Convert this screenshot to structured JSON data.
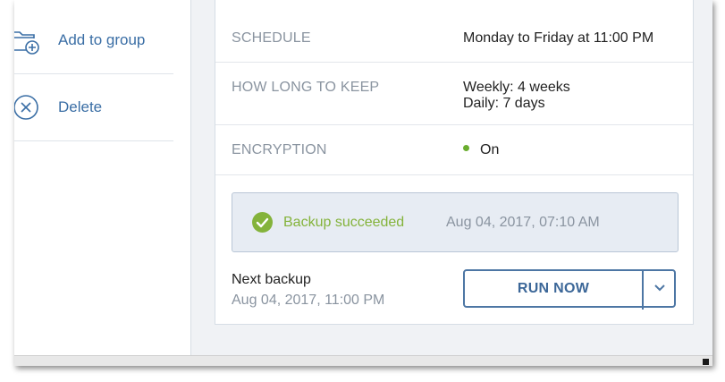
{
  "sidebar": {
    "items": [
      {
        "label": "Add to group",
        "icon": "folder-add-icon"
      },
      {
        "label": "Delete",
        "icon": "close-circle-icon"
      }
    ]
  },
  "details": {
    "schedule": {
      "key": "SCHEDULE",
      "value": "Monday to Friday at 11:00 PM"
    },
    "retention": {
      "key": "HOW LONG TO KEEP",
      "weekly": "Weekly: 4 weeks",
      "daily": "Daily: 7 days"
    },
    "encryption": {
      "key": "ENCRYPTION",
      "value": "On",
      "status_color": "#6aad2e"
    }
  },
  "status": {
    "text": "Backup succeeded",
    "time": "Aug 04, 2017, 07:10 AM",
    "icon": "check-circle-icon",
    "color": "#84b33b"
  },
  "next_backup": {
    "label": "Next backup",
    "time": "Aug 04, 2017, 11:00 PM"
  },
  "actions": {
    "run_now_label": "RUN NOW",
    "dropdown_icon": "chevron-down-icon",
    "accent": "#4d76a4"
  }
}
